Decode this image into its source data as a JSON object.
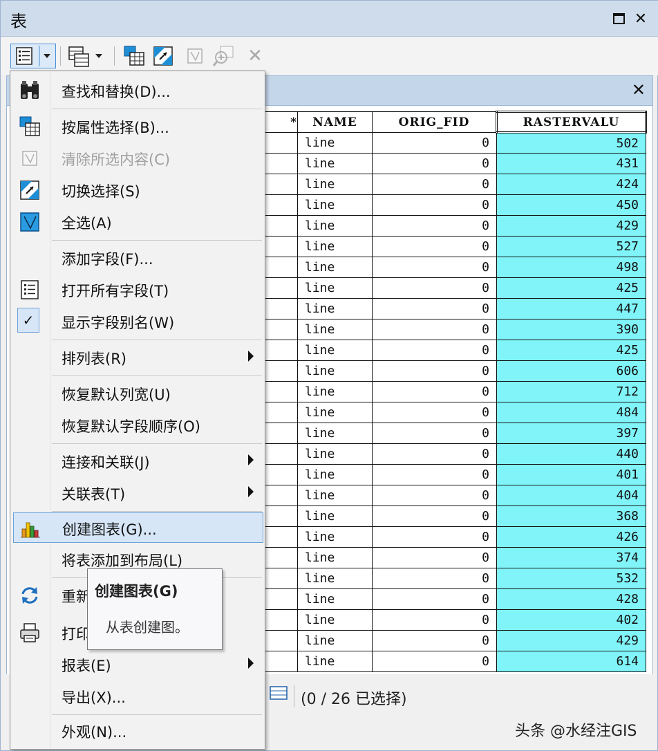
{
  "window": {
    "title": "表"
  },
  "table": {
    "columns": [
      "*",
      "NAME",
      "ORIG_FID",
      "RASTERVALU"
    ],
    "rows": [
      [
        "line",
        "0",
        "502"
      ],
      [
        "line",
        "0",
        "431"
      ],
      [
        "line",
        "0",
        "424"
      ],
      [
        "line",
        "0",
        "450"
      ],
      [
        "line",
        "0",
        "429"
      ],
      [
        "line",
        "0",
        "527"
      ],
      [
        "line",
        "0",
        "498"
      ],
      [
        "line",
        "0",
        "425"
      ],
      [
        "line",
        "0",
        "447"
      ],
      [
        "line",
        "0",
        "390"
      ],
      [
        "line",
        "0",
        "425"
      ],
      [
        "line",
        "0",
        "606"
      ],
      [
        "line",
        "0",
        "712"
      ],
      [
        "line",
        "0",
        "484"
      ],
      [
        "line",
        "0",
        "397"
      ],
      [
        "line",
        "0",
        "440"
      ],
      [
        "line",
        "0",
        "401"
      ],
      [
        "line",
        "0",
        "404"
      ],
      [
        "line",
        "0",
        "368"
      ],
      [
        "line",
        "0",
        "426"
      ],
      [
        "line",
        "0",
        "374"
      ],
      [
        "line",
        "0",
        "532"
      ],
      [
        "line",
        "0",
        "428"
      ],
      [
        "line",
        "0",
        "402"
      ],
      [
        "line",
        "0",
        "429"
      ],
      [
        "line",
        "0",
        "614"
      ]
    ]
  },
  "menu": {
    "find_replace": "查找和替换(D)...",
    "select_by_attr": "按属性选择(B)...",
    "clear_selection": "清除所选内容(C)",
    "switch_selection": "切换选择(S)",
    "select_all": "全选(A)",
    "add_field": "添加字段(F)...",
    "open_all_fields": "打开所有字段(T)",
    "show_alias": "显示字段别名(W)",
    "arrange_tables": "排列表(R)",
    "restore_width": "恢复默认列宽(U)",
    "restore_order": "恢复默认字段顺序(O)",
    "joins_relates": "连接和关联(J)",
    "related_tables": "关联表(T)",
    "create_graph": "创建图表(G)...",
    "add_to_layout": "将表添加到布局(L)",
    "reload_cache": "重新",
    "print": "打印",
    "reports": "报表(E)",
    "export": "导出(X)...",
    "appearance": "外观(N)..."
  },
  "tooltip": {
    "title": "创建图表(G)",
    "body": "从表创建图。"
  },
  "status": {
    "selection": "(0 / 26 已选择)"
  },
  "watermark": "头条 @水经注GIS",
  "colors": {
    "selected_column": "#80f4f8",
    "highlight": "#d6e6f7",
    "titlebar": "#cfdcec"
  }
}
